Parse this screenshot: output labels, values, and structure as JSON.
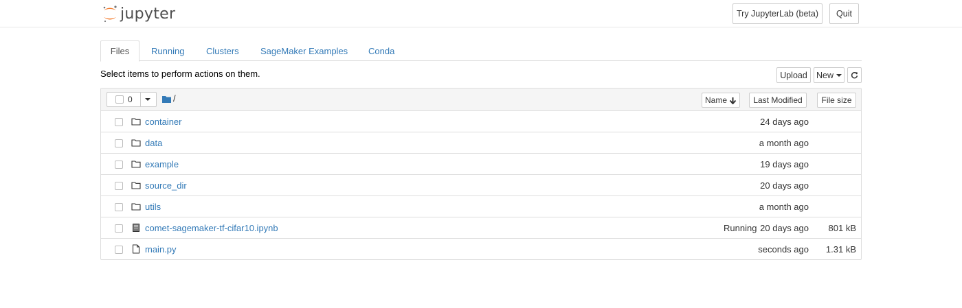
{
  "header": {
    "logo_text": "jupyter",
    "buttons": {
      "try_lab": "Try JupyterLab (beta)",
      "quit": "Quit"
    }
  },
  "tabs": [
    {
      "label": "Files",
      "active": true
    },
    {
      "label": "Running",
      "active": false
    },
    {
      "label": "Clusters",
      "active": false
    },
    {
      "label": "SageMaker Examples",
      "active": false
    },
    {
      "label": "Conda",
      "active": false
    }
  ],
  "toolbar": {
    "hint": "Select items to perform actions on them.",
    "upload": "Upload",
    "new": "New",
    "refresh_icon": "refresh-icon"
  },
  "list_header": {
    "selected_count": "0",
    "breadcrumb": "/",
    "sort_name": "Name",
    "sort_modified": "Last Modified",
    "sort_size": "File size"
  },
  "files": [
    {
      "type": "folder",
      "name": "container",
      "status": "",
      "modified": "24 days ago",
      "size": ""
    },
    {
      "type": "folder",
      "name": "data",
      "status": "",
      "modified": "a month ago",
      "size": ""
    },
    {
      "type": "folder",
      "name": "example",
      "status": "",
      "modified": "19 days ago",
      "size": ""
    },
    {
      "type": "folder",
      "name": "source_dir",
      "status": "",
      "modified": "20 days ago",
      "size": ""
    },
    {
      "type": "folder",
      "name": "utils",
      "status": "",
      "modified": "a month ago",
      "size": ""
    },
    {
      "type": "notebook",
      "name": "comet-sagemaker-tf-cifar10.ipynb",
      "status": "Running",
      "modified": "20 days ago",
      "size": "801 kB"
    },
    {
      "type": "file",
      "name": "main.py",
      "status": "",
      "modified": "seconds ago",
      "size": "1.31 kB"
    }
  ],
  "colors": {
    "link": "#337ab7",
    "logo_orange": "#f37726",
    "border": "#dddddd"
  }
}
